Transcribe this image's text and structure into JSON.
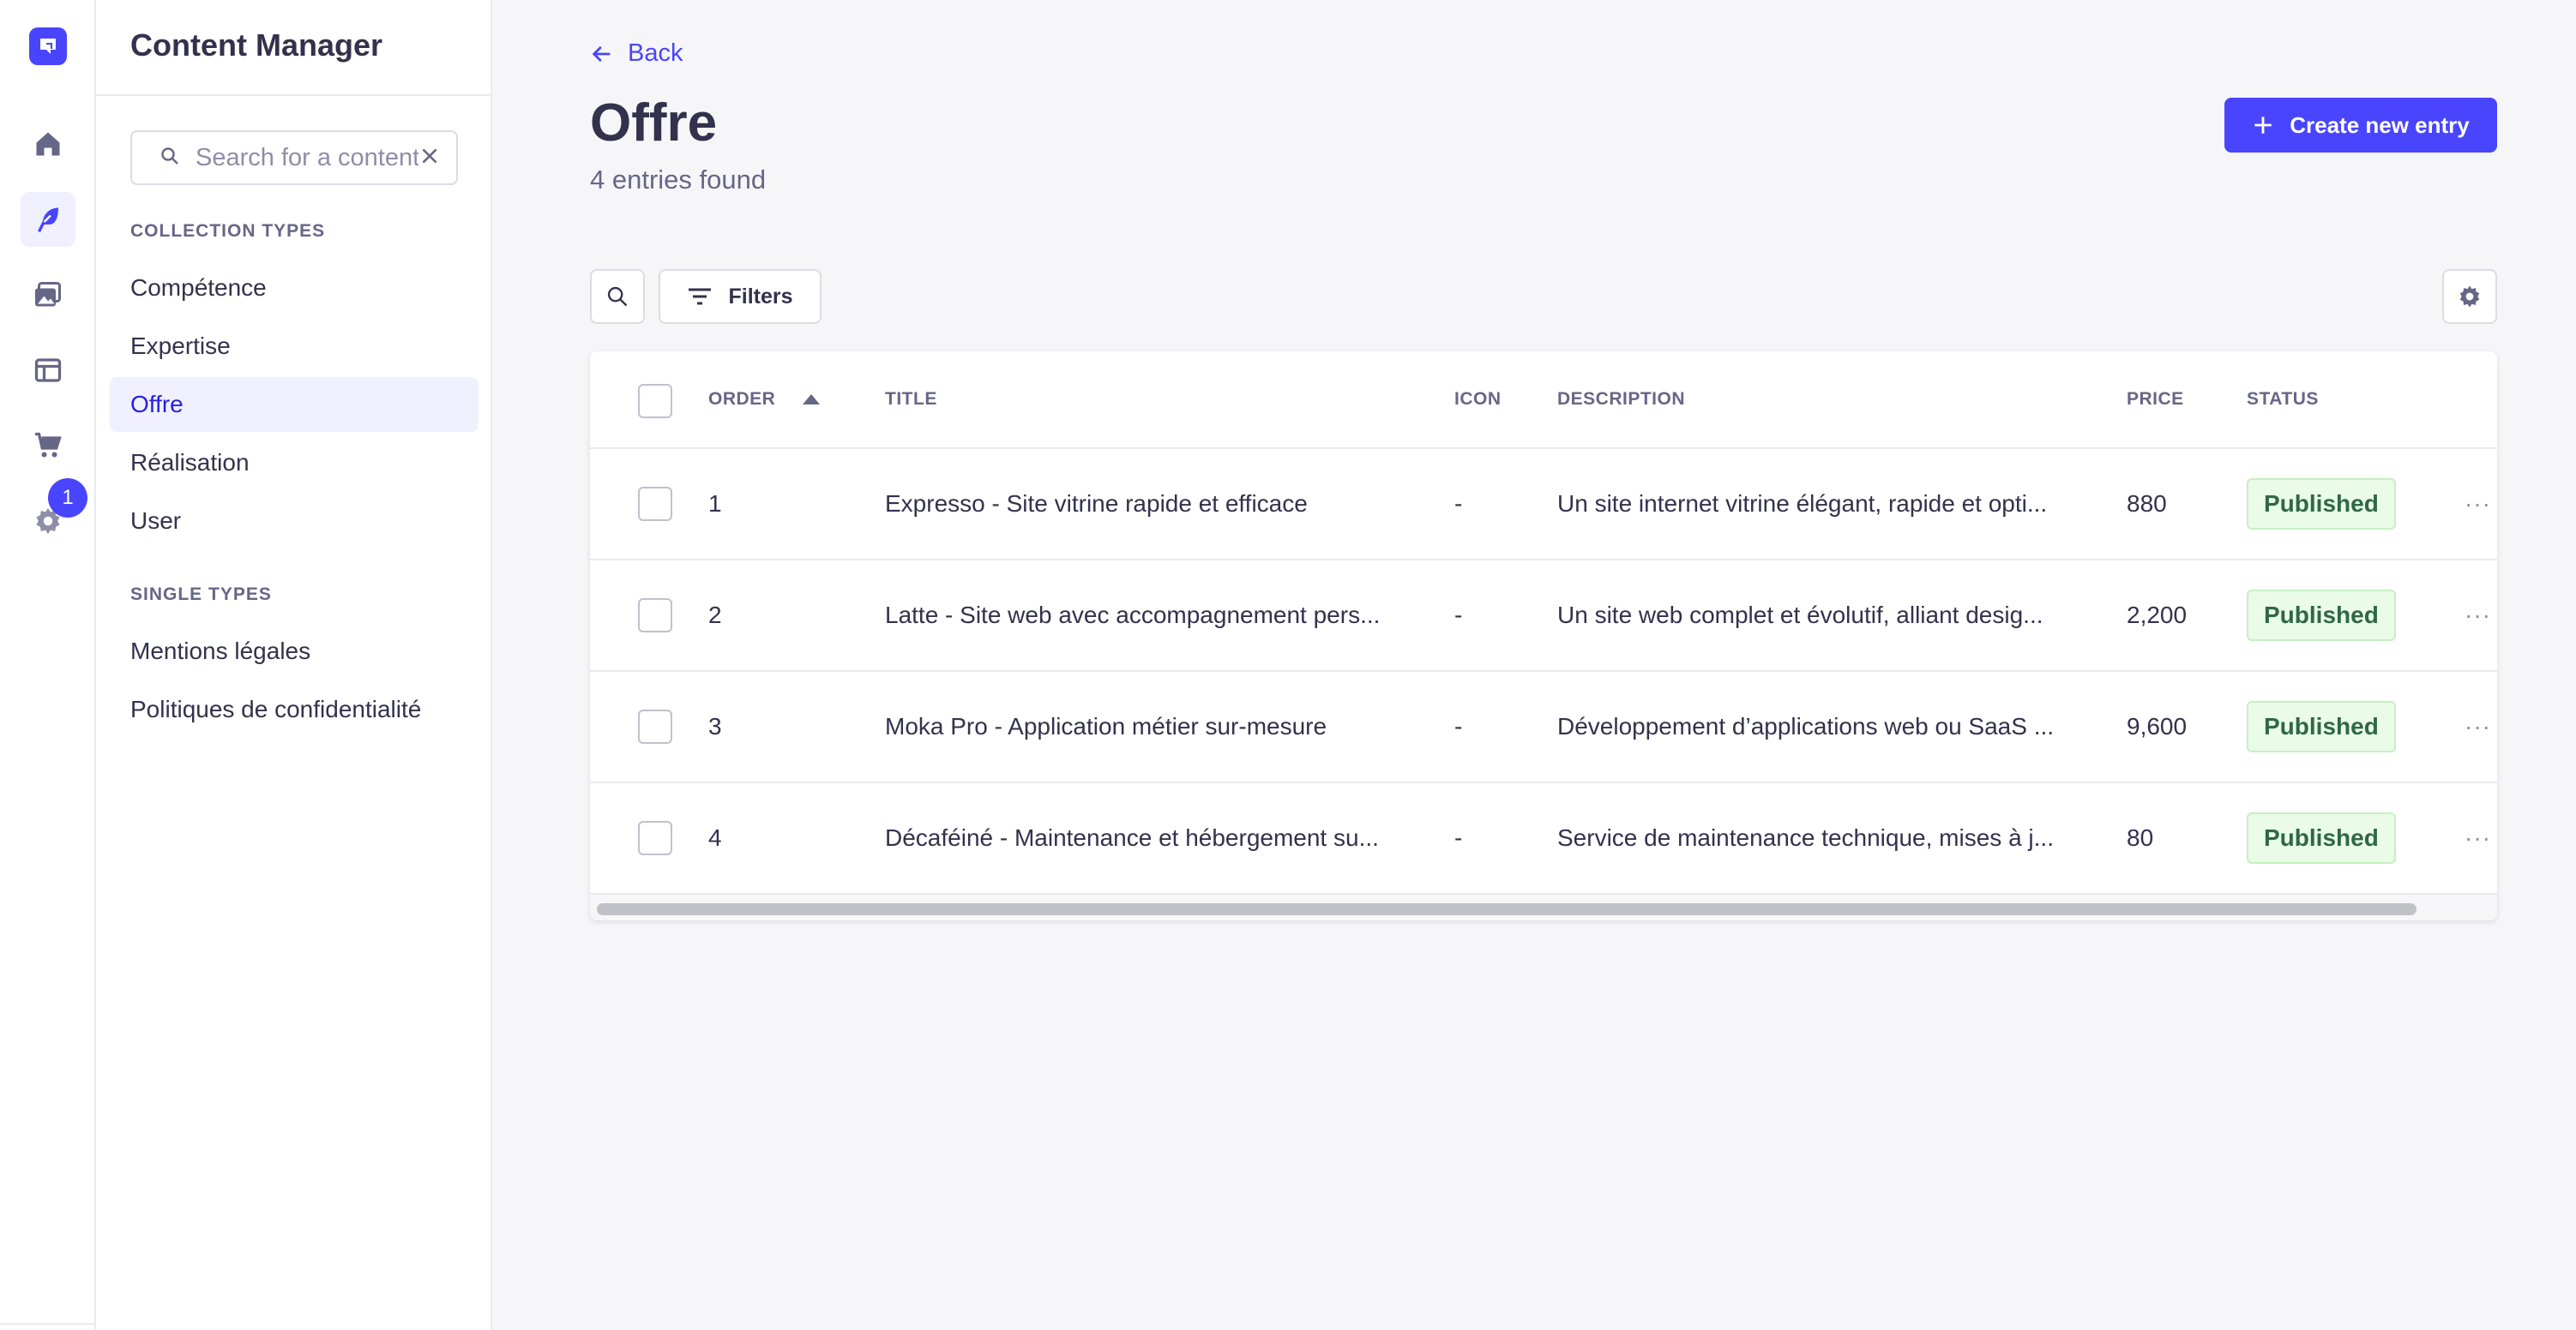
{
  "app": {
    "section_title": "Content Manager",
    "notification_count": "1"
  },
  "sidebar": {
    "search_placeholder": "Search for a content type",
    "collection_types_label": "Collection types",
    "collection_types": [
      {
        "label": "Compétence",
        "active": false
      },
      {
        "label": "Expertise",
        "active": false
      },
      {
        "label": "Offre",
        "active": true
      },
      {
        "label": "Réalisation",
        "active": false
      },
      {
        "label": "User",
        "active": false
      }
    ],
    "single_types_label": "Single types",
    "single_types": [
      {
        "label": "Mentions légales"
      },
      {
        "label": "Politiques de confidentialité"
      }
    ]
  },
  "header": {
    "back_label": "Back",
    "title": "Offre",
    "subtitle": "4 entries found",
    "create_label": "Create new entry"
  },
  "toolbar": {
    "filters_label": "Filters"
  },
  "table": {
    "columns": {
      "order": "Order",
      "title": "Title",
      "icon": "Icon",
      "description": "Description",
      "price": "Price",
      "status": "Status"
    },
    "rows": [
      {
        "order": "1",
        "title": "Expresso - Site vitrine rapide et efficace",
        "icon": "-",
        "description": "Un site internet vitrine élégant, rapide et opti...",
        "price": "880",
        "status": "Published"
      },
      {
        "order": "2",
        "title": "Latte - Site web avec accompagnement pers...",
        "icon": "-",
        "description": "Un site web complet et évolutif, alliant desig...",
        "price": "2,200",
        "status": "Published"
      },
      {
        "order": "3",
        "title": "Moka Pro - Application métier sur-mesure",
        "icon": "-",
        "description": "Développement d’applications web ou SaaS ...",
        "price": "9,600",
        "status": "Published"
      },
      {
        "order": "4",
        "title": "Décaféiné - Maintenance et hébergement su...",
        "icon": "-",
        "description": "Service de maintenance technique, mises à j...",
        "price": "80",
        "status": "Published"
      }
    ]
  },
  "icons": {
    "rail": [
      "logo-icon",
      "home-icon",
      "content-manager-icon",
      "media-library-icon",
      "content-type-builder-icon",
      "marketplace-icon",
      "settings-icon"
    ],
    "more": "more-icon"
  },
  "colors": {
    "primary": "#4945ff",
    "published_text": "#2f6846",
    "published_bg": "#eafbe7"
  }
}
